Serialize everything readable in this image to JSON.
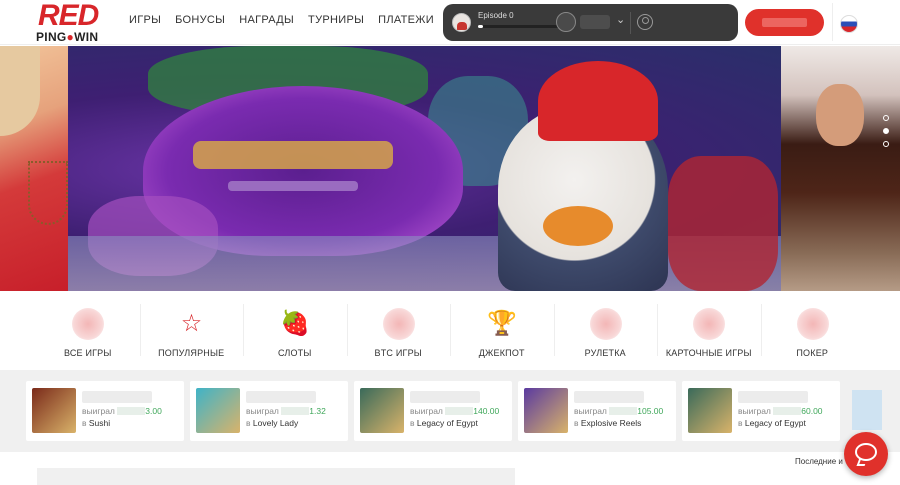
{
  "logo": {
    "top": "RED",
    "bottom_left": "PING",
    "bottom_dot": "●",
    "bottom_right": "WIN"
  },
  "nav": [
    {
      "label": "ИГРЫ"
    },
    {
      "label": "БОНУСЫ"
    },
    {
      "label": "НАГРАДЫ"
    },
    {
      "label": "ТУРНИРЫ"
    },
    {
      "label": "ПЛАТЕЖИ"
    }
  ],
  "episode": {
    "title": "Episode 0",
    "progress": 0.05,
    "chevron": "⌄"
  },
  "language": {
    "flag": "ru-flag-icon"
  },
  "hero": {
    "slides": 3,
    "active_slide": 0
  },
  "categories": [
    {
      "label": "ВСЕ ИГРЫ",
      "icon": "all-games-icon",
      "glyph": ""
    },
    {
      "label": "ПОПУЛЯРНЫЕ",
      "icon": "star-icon",
      "glyph": "☆"
    },
    {
      "label": "СЛОТЫ",
      "icon": "fruits-icon",
      "glyph": "🍓"
    },
    {
      "label": "BTC ИГРЫ",
      "icon": "btc-icon",
      "glyph": ""
    },
    {
      "label": "ДЖЕКПОТ",
      "icon": "trophy-icon",
      "glyph": "🏆"
    },
    {
      "label": "РУЛЕТКА",
      "icon": "roulette-icon",
      "glyph": ""
    },
    {
      "label": "КАРТОЧНЫЕ ИГРЫ",
      "icon": "cards-icon",
      "glyph": ""
    },
    {
      "label": "ПОКЕР",
      "icon": "poker-icon",
      "glyph": ""
    }
  ],
  "wins": [
    {
      "won_label": "выиграл",
      "amount": "3.00",
      "in_label": "в",
      "game": "Sushi",
      "thumb_color": "#7a2a1a"
    },
    {
      "won_label": "выиграл",
      "amount": "1.32",
      "in_label": "в",
      "game": "Lovely Lady",
      "thumb_color": "#3fb3c7"
    },
    {
      "won_label": "выиграл",
      "amount": "140.00",
      "in_label": "в",
      "game": "Legacy of Egypt",
      "thumb_color": "#3a6a5a"
    },
    {
      "won_label": "выиграл",
      "amount": "105.00",
      "in_label": "в",
      "game": "Explosive Reels",
      "thumb_color": "#5a3aa0"
    },
    {
      "won_label": "выиграл",
      "amount": "60.00",
      "in_label": "в",
      "game": "Legacy of Egypt",
      "thumb_color": "#3a6a5a"
    }
  ],
  "recent": {
    "text": "Последние и"
  },
  "colors": {
    "brand": "#d8262a",
    "win_amount": "#3fa75a"
  }
}
